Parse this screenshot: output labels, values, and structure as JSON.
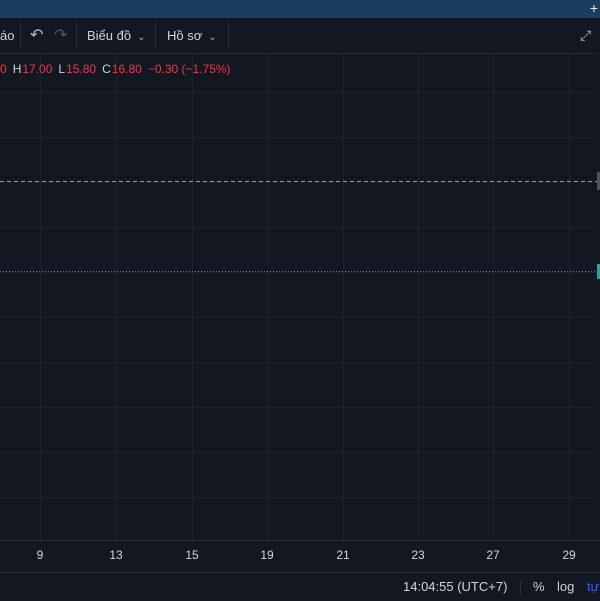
{
  "toolbar": {
    "partial_left_label": "áo",
    "chart_menu_label": "Biểu đồ",
    "profile_menu_label": "Hồ sơ",
    "icons": [
      "undo-icon",
      "redo-icon",
      "chevron-down-icon",
      "fullscreen-icon",
      "plus-icon"
    ]
  },
  "ohlc": {
    "open_tail": "0",
    "high_key": "H",
    "high": "17.00",
    "low_key": "L",
    "low": "15.80",
    "close_key": "C",
    "close": "16.80",
    "change": "−0.30 (−1.75%)"
  },
  "x_axis_labels": [
    "9",
    "13",
    "15",
    "19",
    "21",
    "23",
    "27",
    "29"
  ],
  "status": {
    "time": "14:04:55 (UTC+7)",
    "percent_label": "%",
    "log_label": "log",
    "auto_partial": "tự"
  },
  "colors": {
    "background": "#131722",
    "grid": "#1e2230",
    "down": "#f23645",
    "accent": "#2962ff",
    "price_line": "#26a69a"
  }
}
